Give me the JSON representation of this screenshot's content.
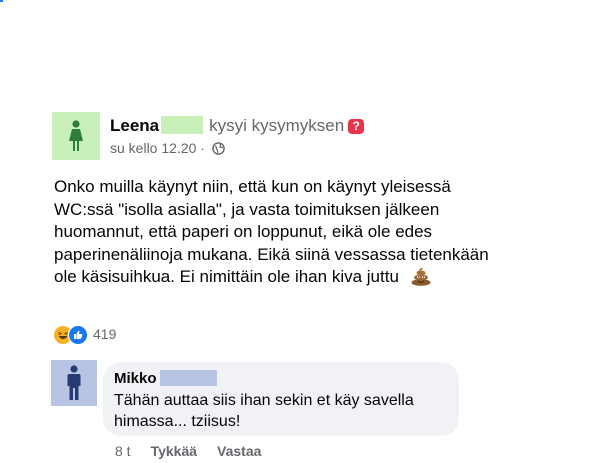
{
  "post": {
    "author_name": "Leena",
    "action": "kysyi kysymyksen",
    "badge": "?",
    "time": "su kello 12.20",
    "separator": "·",
    "body": "Onko muilla käynyt niin, että kun on käynyt yleisessä WC:ssä \"isolla asialla\", ja vasta toimituksen jälkeen huomannut, että paperi on loppunut, eikä ole edes paperinenäliinoja mukana. Eikä siinä vessassa tietenkään ole käsisuihkua. Ei nimittäin ole ihan kiva juttu",
    "emoji": "poo-emoji",
    "reaction_count": "419",
    "reaction_icons": [
      "haha-reaction-icon",
      "like-reaction-icon"
    ]
  },
  "comment": {
    "author_name": "Mikko",
    "text": "Tähän auttaa siis ihan sekin et käy savella himassa... tziisus!",
    "time": "8 t",
    "like_label": "Tykkää",
    "reply_label": "Vastaa"
  },
  "colors": {
    "female_avatar_bg": "#c9f0b9",
    "male_avatar_bg": "#b7c4e3",
    "secondary_text": "#65676b",
    "bubble_bg": "#f0f2f5",
    "question_badge": "#e8344b"
  }
}
